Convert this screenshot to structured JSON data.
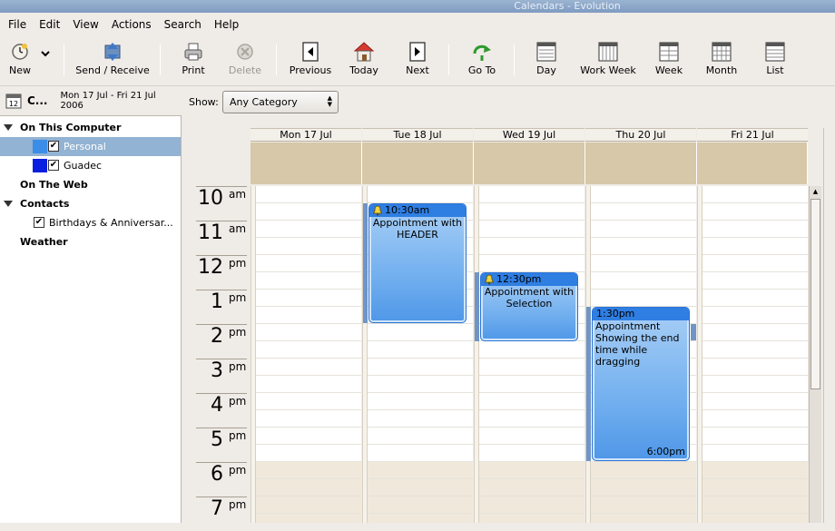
{
  "window": {
    "title": "Calendars - Evolution"
  },
  "menu": [
    "File",
    "Edit",
    "View",
    "Actions",
    "Search",
    "Help"
  ],
  "toolbar": {
    "new": "New",
    "send_receive": "Send / Receive",
    "print": "Print",
    "delete": "Delete",
    "previous": "Previous",
    "today": "Today",
    "next": "Next",
    "goto": "Go To",
    "day": "Day",
    "work_week": "Work Week",
    "week": "Week",
    "month": "Month",
    "list": "List"
  },
  "sidebar": {
    "title": "C...",
    "date_range": "Mon 17 Jul - Fri 21 Jul 2006",
    "groups": [
      {
        "label": "On This Computer"
      },
      {
        "label": "On The Web"
      },
      {
        "label": "Contacts"
      },
      {
        "label": "Weather"
      }
    ],
    "items": [
      {
        "label": "Personal",
        "color": "#3a8ee8",
        "checked": "✔"
      },
      {
        "label": "Guadec",
        "color": "#0a1ee0",
        "checked": "✔"
      },
      {
        "label": "Birthdays & Anniversar...",
        "checked": "✔"
      }
    ]
  },
  "filter": {
    "label": "Show:",
    "value": "Any Category"
  },
  "days": [
    "Mon 17 Jul",
    "Tue 18 Jul",
    "Wed 19 Jul",
    "Thu 20 Jul",
    "Fri 21 Jul"
  ],
  "hours": [
    {
      "h": "10",
      "ap": "am"
    },
    {
      "h": "11",
      "ap": "am"
    },
    {
      "h": "12",
      "ap": "pm"
    },
    {
      "h": "1",
      "ap": "pm"
    },
    {
      "h": "2",
      "ap": "pm"
    },
    {
      "h": "3",
      "ap": "pm"
    },
    {
      "h": "4",
      "ap": "pm"
    },
    {
      "h": "5",
      "ap": "pm"
    },
    {
      "h": "6",
      "ap": "pm"
    },
    {
      "h": "7",
      "ap": "pm"
    }
  ],
  "events": [
    {
      "time": "10:30am",
      "title": "Appointment with HEADER"
    },
    {
      "time": "12:30pm",
      "title": "Appointment with Selection"
    },
    {
      "time": "1:30pm",
      "title": "Appointment Showing the end time while dragging",
      "end": "6:00pm"
    }
  ]
}
